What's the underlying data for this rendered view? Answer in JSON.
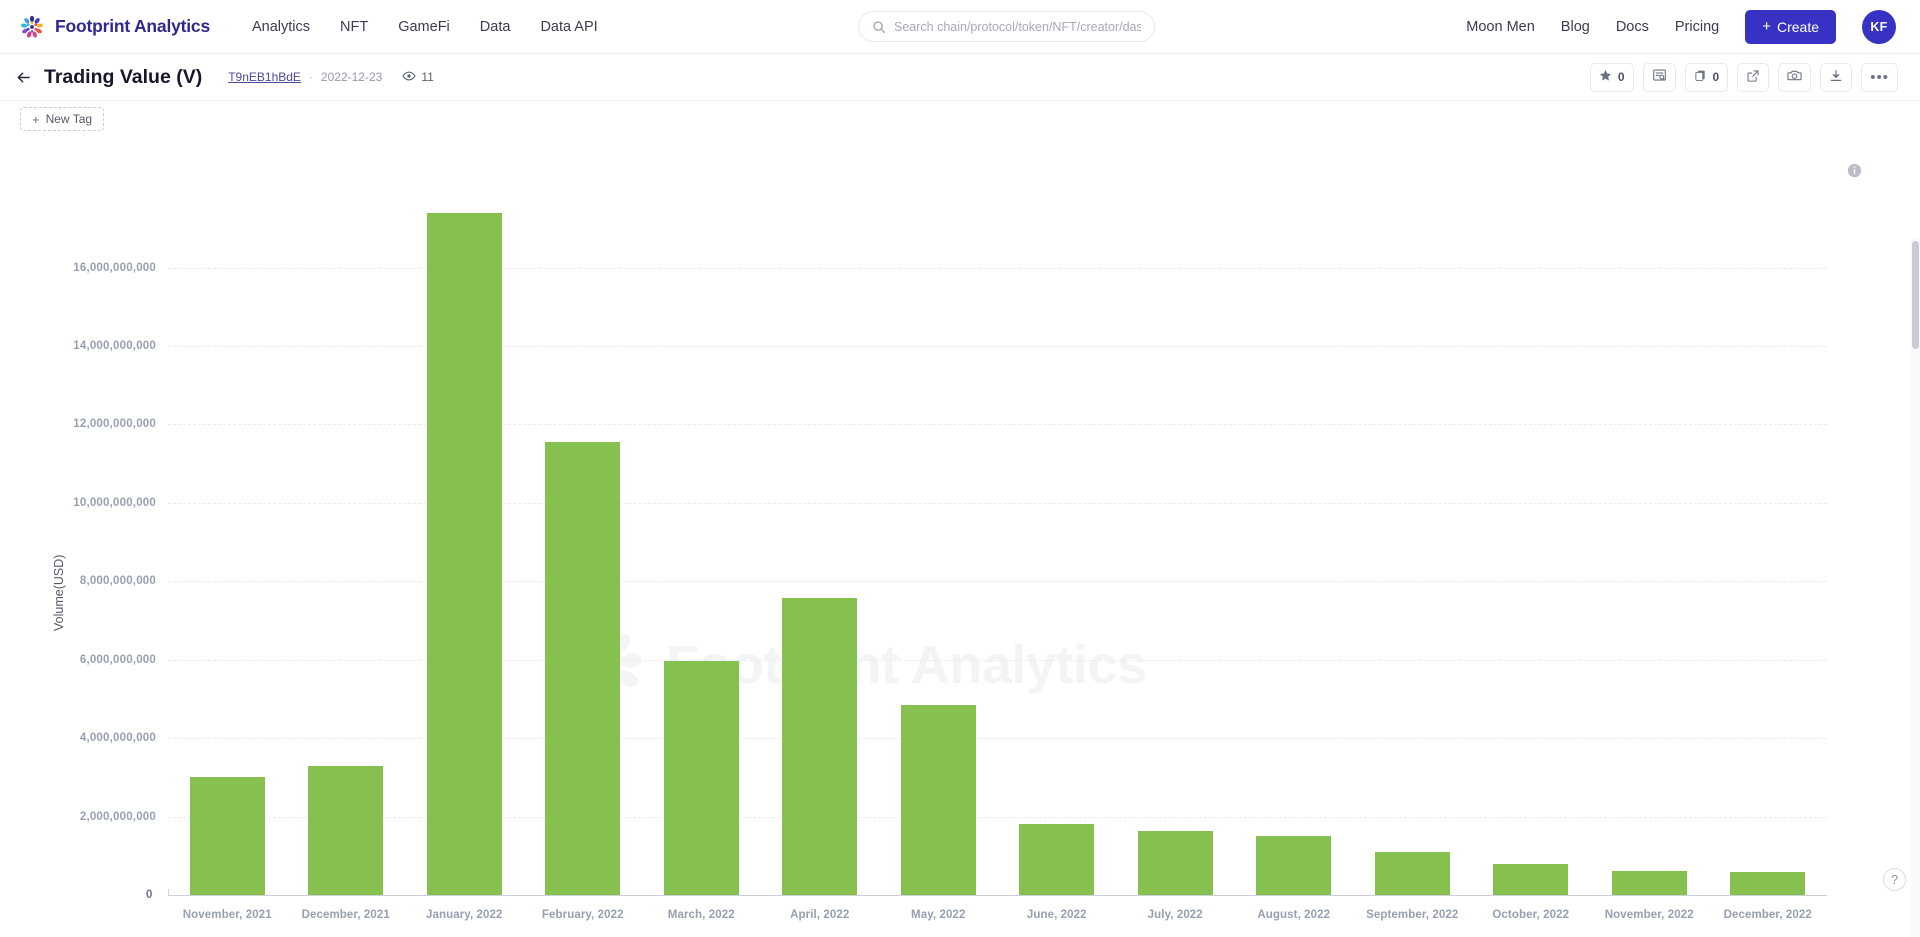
{
  "nav": {
    "brand": "Footprint Analytics",
    "links": [
      "Analytics",
      "NFT",
      "GameFi",
      "Data",
      "Data API"
    ],
    "right_links": [
      "Moon Men",
      "Blog",
      "Docs",
      "Pricing"
    ],
    "create_label": "Create",
    "create_plus": "+",
    "avatar_initials": "KF",
    "brand_color": "#2d2a8c",
    "accent_color": "#3832c4"
  },
  "search": {
    "placeholder": "Search chain/protocol/token/NFT/creator/dashboard...",
    "value": "",
    "icon": "search-icon"
  },
  "titlebar": {
    "back_icon": "arrow-left-icon",
    "title": "Trading Value (V)",
    "owner_link": "T9nEB1hBdE",
    "separator": "·",
    "date": "2022-12-23",
    "views_icon": "eye-icon",
    "views": "11",
    "tools": [
      {
        "name": "favorite-button",
        "icon": "star-icon",
        "count": "0"
      },
      {
        "name": "report-button",
        "icon": "document-search-icon",
        "count": ""
      },
      {
        "name": "duplicate-button",
        "icon": "copy-icon",
        "count": "0"
      },
      {
        "name": "open-external-button",
        "icon": "external-link-icon",
        "count": ""
      },
      {
        "name": "snapshot-button",
        "icon": "camera-icon",
        "count": ""
      },
      {
        "name": "download-button",
        "icon": "download-icon",
        "count": ""
      },
      {
        "name": "more-button",
        "icon": "ellipsis-icon",
        "count": ""
      }
    ]
  },
  "tags": {
    "new_tag_label": "New Tag",
    "new_tag_plus": "+"
  },
  "chart_panel": {
    "info_icon": "info-icon",
    "watermark_text": "Footprint Analytics",
    "help_label": "?"
  },
  "chart_data": {
    "type": "bar",
    "title": "Trading Value (V)",
    "xlabel": "",
    "ylabel": "Volume(USD)",
    "ylim": [
      0,
      17800000000
    ],
    "grid": true,
    "legend": false,
    "bar_color": "#86c04e",
    "y_ticks": [
      0,
      2000000000,
      4000000000,
      6000000000,
      8000000000,
      10000000000,
      12000000000,
      14000000000,
      16000000000
    ],
    "y_tick_labels": [
      "0",
      "2,000,000,000",
      "4,000,000,000",
      "6,000,000,000",
      "8,000,000,000",
      "10,000,000,000",
      "12,000,000,000",
      "14,000,000,000",
      "16,000,000,000"
    ],
    "categories": [
      "November, 2021",
      "December, 2021",
      "January, 2022",
      "February, 2022",
      "March, 2022",
      "April, 2022",
      "May, 2022",
      "June, 2022",
      "July, 2022",
      "August, 2022",
      "September, 2022",
      "October, 2022",
      "November, 2022",
      "December, 2022"
    ],
    "values": [
      3020000000,
      3290000000,
      17400000000,
      11550000000,
      5980000000,
      7580000000,
      4840000000,
      1800000000,
      1620000000,
      1500000000,
      1100000000,
      800000000,
      620000000,
      580000000
    ],
    "series": [
      {
        "name": "Volume(USD)",
        "values": [
          3020000000,
          3290000000,
          17400000000,
          11550000000,
          5980000000,
          7580000000,
          4840000000,
          1800000000,
          1620000000,
          1500000000,
          1100000000,
          800000000,
          620000000,
          580000000
        ]
      }
    ]
  }
}
